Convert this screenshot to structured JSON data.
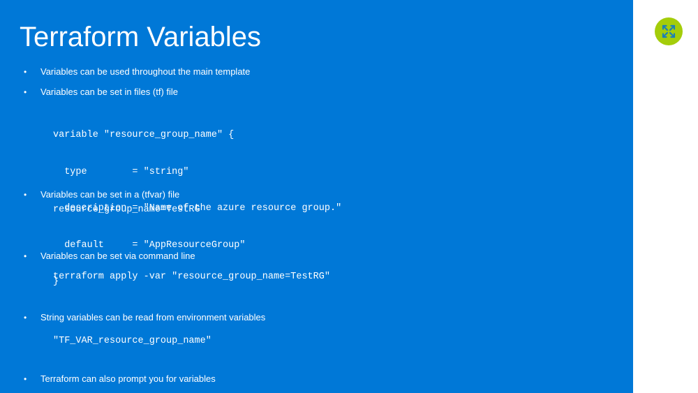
{
  "slide": {
    "title": "Terraform Variables",
    "accent_color": "#0078d7",
    "logo_color": "#a4cd0a",
    "logo_icon": "expand-arrows-icon",
    "bullets": [
      "Variables can be used throughout the main template",
      "Variables can be set in files (tf) file",
      "Variables can be set in a (tfvar) file",
      "Variables can be set via command line",
      "String variables can be read from environment variables",
      "Terraform can also prompt you for variables"
    ],
    "code": {
      "tf_block": [
        "variable \"resource_group_name\" {",
        "  type        = \"string\"",
        "  description = \"Name of the azure resource group.\"",
        "  default     = \"AppResourceGroup\"",
        "}"
      ],
      "tfvar": "resource_group_name=TestRG",
      "cli": "terraform apply -var \"resource_group_name=TestRG\"",
      "env": "\"TF_VAR_resource_group_name\""
    },
    "bullet_glyph": "•"
  }
}
